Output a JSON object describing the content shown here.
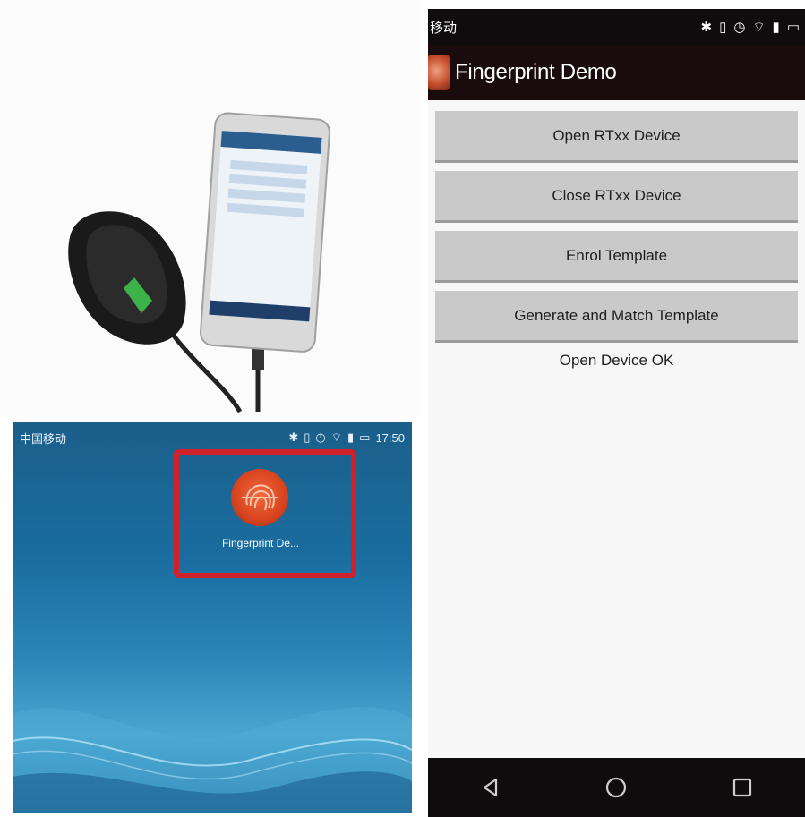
{
  "home": {
    "carrier": "中国移动",
    "time": "17:50",
    "app_label": "Fingerprint De..."
  },
  "app": {
    "carrier": "移动",
    "title": "Fingerprint Demo",
    "buttons": [
      {
        "label": "Open RTxx Device"
      },
      {
        "label": "Close RTxx Device"
      },
      {
        "label": "Enrol Template"
      },
      {
        "label": "Generate and Match Template"
      }
    ],
    "status_message": "Open Device OK"
  },
  "icons": {
    "status": [
      "bluetooth-icon",
      "vibrate-icon",
      "alarm-icon",
      "wifi-icon",
      "signal-icon",
      "battery-icon"
    ],
    "navbar": [
      "back-icon",
      "home-icon",
      "recents-icon"
    ]
  },
  "colors": {
    "button_bg": "#c9c9c9",
    "titlebar_bg": "#1a0c0c",
    "status_bg": "#0e0c0c",
    "highlight_border": "#d0202a",
    "home_bg": "#1a6da0"
  }
}
